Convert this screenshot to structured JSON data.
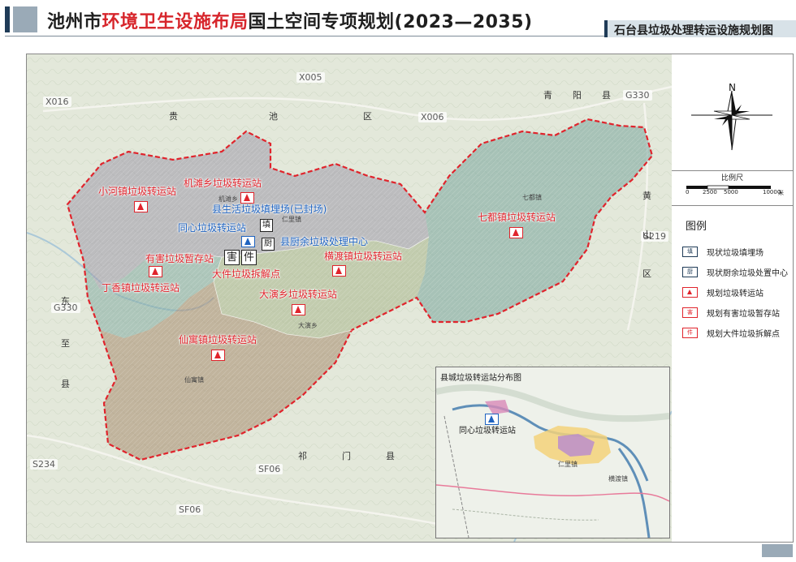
{
  "header": {
    "title_prefix": "池州市",
    "title_highlight": "环境卫生设施布局",
    "title_suffix": "国土空间专项规划(2023—2035)",
    "subtitle": "石台县垃圾处理转运设施规划图"
  },
  "roads": [
    "X005",
    "X016",
    "X006",
    "G330",
    "S219",
    "G330",
    "S234",
    "SF06",
    "SF06"
  ],
  "neighbor_counties": [
    "贵",
    "池",
    "区",
    "青",
    "阳",
    "县",
    "黄",
    "山",
    "区",
    "东",
    "至",
    "县",
    "祁",
    "门",
    "县"
  ],
  "town_small_labels": [
    "机滩乡",
    "仁里镇",
    "七都镇",
    "大演乡",
    "仙寓镇"
  ],
  "facilities": {
    "xiaohe": "小河镇垃圾转运站",
    "jitan": "机滩乡垃圾转运站",
    "landfill": "县生活垃圾填埋场(已封场)",
    "tongxin": "同心垃圾转运站",
    "kitchen": "县厨余垃圾处理中心",
    "qidu": "七都镇垃圾转运站",
    "hazardous": "有害垃圾暂存站",
    "hengdu": "横渡镇垃圾转运站",
    "bulky": "大件垃圾拆解点",
    "dingxiang": "丁香镇垃圾转运站",
    "dayan": "大演乡垃圾转运站",
    "xianyu": "仙寓镇垃圾转运站"
  },
  "icon_chars": {
    "landfill": "填",
    "kitchen": "厨",
    "hazardous": "害",
    "bulky": "件"
  },
  "inset": {
    "title": "县城垃圾转运站分布图",
    "station_label": "同心垃圾转运站",
    "towns": [
      "仁里镇",
      "横渡镇"
    ]
  },
  "compass": {
    "north": "N"
  },
  "scale": {
    "title": "比例尺",
    "ticks": [
      "0",
      "2500",
      "5000",
      "10000"
    ],
    "unit": "米"
  },
  "legend": {
    "title": "图例",
    "items": [
      {
        "icon": "填",
        "label": "现状垃圾填埋场"
      },
      {
        "icon": "厨",
        "label": "现状厨余垃圾处置中心"
      },
      {
        "icon": "",
        "label": "规划垃圾转运站"
      },
      {
        "icon": "害",
        "label": "规划有害垃圾暂存站"
      },
      {
        "icon": "件",
        "label": "规划大件垃圾拆解点"
      }
    ]
  },
  "colors": {
    "boundary": "#e0242c",
    "station_red": "#e0242c",
    "label_blue": "#1e63c0",
    "header_dark": "#1f3b57",
    "header_grey": "#9aaab7"
  }
}
